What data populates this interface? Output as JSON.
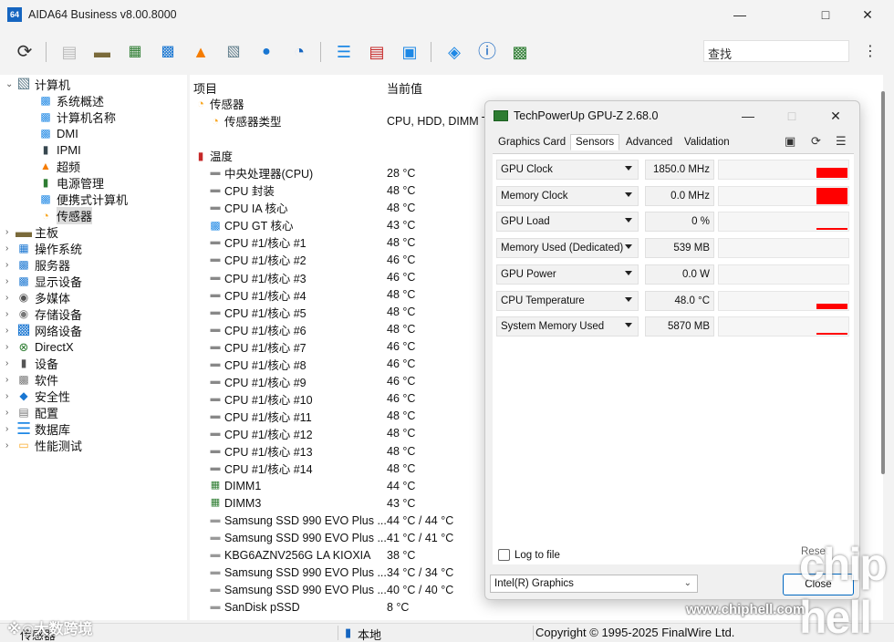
{
  "window": {
    "title": "AIDA64 Business v8.00.8000",
    "app_icon_text": "64"
  },
  "toolbar": {
    "buttons": [
      "refresh-icon",
      "report-icon",
      "motherboard-icon",
      "memory-icon",
      "network-icon",
      "flame-icon",
      "computer-icon",
      "user-icon",
      "disk-chart-icon",
      "database-icon",
      "schedule-report-icon",
      "monitor-icon",
      "network-audit-icon",
      "info-icon",
      "network-share-icon"
    ],
    "search_placeholder": "查找"
  },
  "tree": [
    {
      "label": "计算机",
      "level": 0,
      "arrow": "v",
      "icon": "computer-icon"
    },
    {
      "label": "系统概述",
      "level": 1,
      "icon": "summary-icon"
    },
    {
      "label": "计算机名称",
      "level": 1,
      "icon": "computer-name-icon"
    },
    {
      "label": "DMI",
      "level": 1,
      "icon": "dmi-icon"
    },
    {
      "label": "IPMI",
      "level": 1,
      "icon": "ipmi-icon"
    },
    {
      "label": "超频",
      "level": 1,
      "icon": "overclock-icon"
    },
    {
      "label": "电源管理",
      "level": 1,
      "icon": "power-icon"
    },
    {
      "label": "便携式计算机",
      "level": 1,
      "icon": "laptop-icon"
    },
    {
      "label": "传感器",
      "level": 1,
      "icon": "sensor-icon",
      "selected": true
    },
    {
      "label": "主板",
      "level": 0,
      "arrow": ">",
      "icon": "motherboard-icon"
    },
    {
      "label": "操作系统",
      "level": 0,
      "arrow": ">",
      "icon": "os-icon"
    },
    {
      "label": "服务器",
      "level": 0,
      "arrow": ">",
      "icon": "server-icon"
    },
    {
      "label": "显示设备",
      "level": 0,
      "arrow": ">",
      "icon": "display-icon"
    },
    {
      "label": "多媒体",
      "level": 0,
      "arrow": ">",
      "icon": "multimedia-icon"
    },
    {
      "label": "存储设备",
      "level": 0,
      "arrow": ">",
      "icon": "storage-icon"
    },
    {
      "label": "网络设备",
      "level": 0,
      "arrow": ">",
      "icon": "network-icon"
    },
    {
      "label": "DirectX",
      "level": 0,
      "arrow": ">",
      "icon": "directx-icon"
    },
    {
      "label": "设备",
      "level": 0,
      "arrow": ">",
      "icon": "devices-icon"
    },
    {
      "label": "软件",
      "level": 0,
      "arrow": ">",
      "icon": "software-icon"
    },
    {
      "label": "安全性",
      "level": 0,
      "arrow": ">",
      "icon": "security-icon"
    },
    {
      "label": "配置",
      "level": 0,
      "arrow": ">",
      "icon": "config-icon"
    },
    {
      "label": "数据库",
      "level": 0,
      "arrow": ">",
      "icon": "database-icon"
    },
    {
      "label": "性能测试",
      "level": 0,
      "arrow": ">",
      "icon": "benchmark-icon"
    }
  ],
  "list": {
    "headers": {
      "item": "项目",
      "value": "当前值"
    },
    "rows": [
      {
        "name": "传感器",
        "value": "",
        "type": "section",
        "icon": "sensor-icon"
      },
      {
        "name": "传感器类型",
        "value": "CPU, HDD, DIMM T",
        "type": "item",
        "icon": "sensor-icon"
      },
      {
        "name": "",
        "value": "",
        "type": "spacer"
      },
      {
        "name": "温度",
        "value": "",
        "type": "section",
        "icon": "thermometer-icon"
      },
      {
        "name": "中央处理器(CPU)",
        "value": "28 °C",
        "type": "item",
        "icon": "cpu-icon"
      },
      {
        "name": "CPU 封装",
        "value": "48 °C",
        "type": "item",
        "icon": "cpu-icon"
      },
      {
        "name": "CPU IA 核心",
        "value": "48 °C",
        "type": "item",
        "icon": "cpu-icon"
      },
      {
        "name": "CPU GT 核心",
        "value": "43 °C",
        "type": "item",
        "icon": "gpu-icon"
      },
      {
        "name": "CPU #1/核心 #1",
        "value": "48 °C",
        "type": "item",
        "icon": "cpu-icon"
      },
      {
        "name": "CPU #1/核心 #2",
        "value": "46 °C",
        "type": "item",
        "icon": "cpu-icon"
      },
      {
        "name": "CPU #1/核心 #3",
        "value": "46 °C",
        "type": "item",
        "icon": "cpu-icon"
      },
      {
        "name": "CPU #1/核心 #4",
        "value": "48 °C",
        "type": "item",
        "icon": "cpu-icon"
      },
      {
        "name": "CPU #1/核心 #5",
        "value": "48 °C",
        "type": "item",
        "icon": "cpu-icon"
      },
      {
        "name": "CPU #1/核心 #6",
        "value": "48 °C",
        "type": "item",
        "icon": "cpu-icon"
      },
      {
        "name": "CPU #1/核心 #7",
        "value": "46 °C",
        "type": "item",
        "icon": "cpu-icon"
      },
      {
        "name": "CPU #1/核心 #8",
        "value": "46 °C",
        "type": "item",
        "icon": "cpu-icon"
      },
      {
        "name": "CPU #1/核心 #9",
        "value": "46 °C",
        "type": "item",
        "icon": "cpu-icon"
      },
      {
        "name": "CPU #1/核心 #10",
        "value": "46 °C",
        "type": "item",
        "icon": "cpu-icon"
      },
      {
        "name": "CPU #1/核心 #11",
        "value": "48 °C",
        "type": "item",
        "icon": "cpu-icon"
      },
      {
        "name": "CPU #1/核心 #12",
        "value": "48 °C",
        "type": "item",
        "icon": "cpu-icon"
      },
      {
        "name": "CPU #1/核心 #13",
        "value": "48 °C",
        "type": "item",
        "icon": "cpu-icon"
      },
      {
        "name": "CPU #1/核心 #14",
        "value": "48 °C",
        "type": "item",
        "icon": "cpu-icon"
      },
      {
        "name": "DIMM1",
        "value": "44 °C",
        "type": "item",
        "icon": "dimm-icon"
      },
      {
        "name": "DIMM3",
        "value": "43 °C",
        "type": "item",
        "icon": "dimm-icon"
      },
      {
        "name": "Samsung SSD 990 EVO Plus ...",
        "value": "44 °C / 44 °C",
        "type": "item",
        "icon": "ssd-icon"
      },
      {
        "name": "Samsung SSD 990 EVO Plus ...",
        "value": "41 °C / 41 °C",
        "type": "item",
        "icon": "ssd-icon"
      },
      {
        "name": "KBG6AZNV256G LA KIOXIA",
        "value": "38 °C",
        "type": "item",
        "icon": "ssd-icon"
      },
      {
        "name": "Samsung SSD 990 EVO Plus ...",
        "value": "34 °C / 34 °C",
        "type": "item",
        "icon": "ssd-icon"
      },
      {
        "name": "Samsung SSD 990 EVO Plus ...",
        "value": "40 °C / 40 °C",
        "type": "item",
        "icon": "ssd-icon"
      },
      {
        "name": "SanDisk pSSD",
        "value": "8 °C",
        "type": "item",
        "icon": "ssd-icon"
      }
    ]
  },
  "status": {
    "left": "传感器",
    "middle": "本地",
    "right": "Copyright © 1995-2025 FinalWire Ltd."
  },
  "gpuz": {
    "title": "TechPowerUp GPU-Z 2.68.0",
    "tabs": [
      "Graphics Card",
      "Sensors",
      "Advanced",
      "Validation"
    ],
    "active_tab": "Sensors",
    "sensors": [
      {
        "name": "GPU Clock",
        "value": "1850.0 MHz",
        "graph_level": 0.55
      },
      {
        "name": "Memory Clock",
        "value": "0.0 MHz",
        "graph_level": 0.9
      },
      {
        "name": "GPU Load",
        "value": "0 %",
        "graph_level": 0.05
      },
      {
        "name": "Memory Used (Dedicated)",
        "value": "539 MB",
        "graph_level": 0.0
      },
      {
        "name": "GPU Power",
        "value": "0.0 W",
        "graph_level": 0.0
      },
      {
        "name": "CPU Temperature",
        "value": "48.0 °C",
        "graph_level": 0.3
      },
      {
        "name": "System Memory Used",
        "value": "5870 MB",
        "graph_level": 0.05
      }
    ],
    "log_label": "Log to file",
    "reset_label": "Reset",
    "gpu_select": "Intel(R) Graphics",
    "close_label": "Close",
    "graph_color": "#ff0000"
  },
  "watermark": {
    "site": "www.chiphell.com",
    "logo": "chip hell",
    "left": "※◎大数跨境"
  }
}
